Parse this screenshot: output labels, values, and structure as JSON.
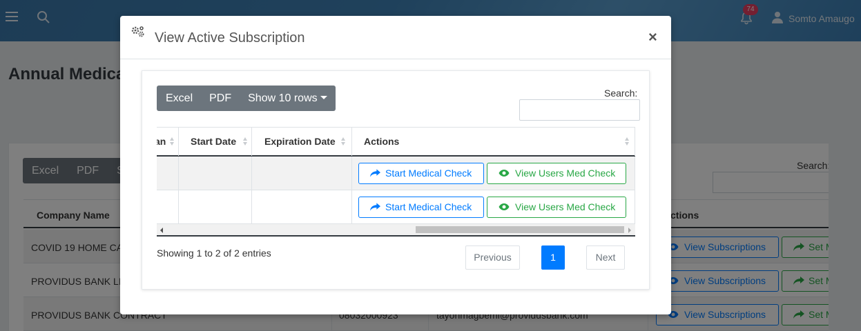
{
  "topbar": {
    "notification_count": "74",
    "user_name": "Somto Amaugo"
  },
  "background_page": {
    "title": "Annual Medica",
    "buttons": [
      "Excel",
      "PDF",
      "Sh"
    ],
    "search_label": "Search:",
    "columns": [
      "Company Name",
      "ctions"
    ],
    "rows": [
      {
        "company": "COVID 19 HOME CA",
        "phone": "",
        "email": ""
      },
      {
        "company": "PROVIDUS BANK LIM",
        "phone": "",
        "email": ""
      },
      {
        "company": "PROVIDUS BANK CONTRACT",
        "phone": "08032000923",
        "email": "tayonmagbemi@providusbank.com"
      }
    ],
    "view_subscriptions_label": "View Subscriptions",
    "set_label": "Set M"
  },
  "modal": {
    "title": "View Active Subscription",
    "close": "×",
    "toolbar": {
      "excel": "Excel",
      "pdf": "PDF",
      "show_rows": "Show 10 rows"
    },
    "search_label": "Search:",
    "search_value": "",
    "columns": {
      "plan_partial": "an",
      "start_date": "Start Date",
      "expiration_date": "Expiration Date",
      "actions": "Actions"
    },
    "rows": [
      {
        "start_date": "",
        "expiration_date": "",
        "start_label": "Start Medical Check",
        "view_label": "View Users Med Check"
      },
      {
        "start_date": "",
        "expiration_date": "",
        "start_label": "Start Medical Check",
        "view_label": "View Users Med Check"
      }
    ],
    "info": "Showing 1 to 2 of 2 entries",
    "pagination": {
      "previous": "Previous",
      "current": "1",
      "next": "Next"
    }
  },
  "colors": {
    "primary": "#007bff",
    "success": "#28a745",
    "secondary": "#6c757d",
    "badge": "#e83e63"
  }
}
